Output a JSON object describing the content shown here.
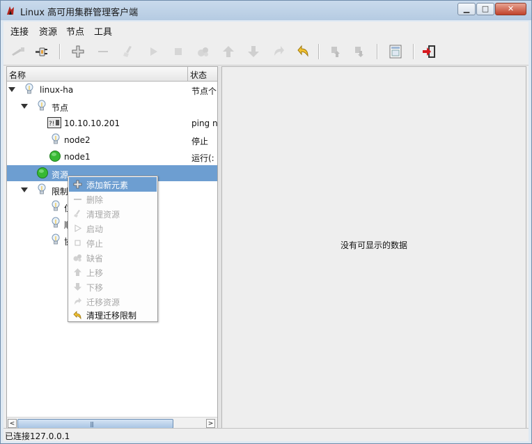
{
  "window": {
    "title": "Linux 高可用集群管理客户端"
  },
  "menubar": {
    "items": [
      "连接",
      "资源",
      "节点",
      "工具"
    ]
  },
  "toolbar": {
    "buttons": [
      "disconnect-icon",
      "connect-icon",
      "add-icon",
      "remove-icon",
      "cleanup-icon",
      "start-icon",
      "stop-icon",
      "default-icon",
      "move-up-icon",
      "move-down-icon",
      "migrate-icon",
      "clear-migration-icon",
      "node-standby-icon",
      "node-online-icon",
      "view-xml-icon",
      "exit-icon"
    ]
  },
  "tree": {
    "headers": {
      "name": "名称",
      "status": "状态"
    },
    "rows": [
      {
        "label": "linux-ha",
        "status": "节点个",
        "icon": "bulb-icon"
      },
      {
        "label": "节点",
        "status": "",
        "icon": "bulb-icon"
      },
      {
        "label": "10.10.10.201",
        "status": "ping n",
        "icon": "ping-node-icon"
      },
      {
        "label": "node2",
        "status": "停止",
        "icon": "bulb-icon"
      },
      {
        "label": "node1",
        "status": "运行(:",
        "icon": "green-circle-icon"
      },
      {
        "label": "资源",
        "status": "",
        "icon": "green-circle-icon"
      },
      {
        "label": "限制",
        "status": "",
        "icon": "bulb-icon"
      },
      {
        "label": "位",
        "status": "",
        "icon": "bulb-icon"
      },
      {
        "label": "顺",
        "status": "",
        "icon": "bulb-icon"
      },
      {
        "label": "协",
        "status": "",
        "icon": "bulb-icon"
      }
    ]
  },
  "right_panel": {
    "empty_message": "没有可显示的数据"
  },
  "statusbar": {
    "text": "已连接127.0.0.1"
  },
  "context_menu": {
    "items": [
      {
        "label": "添加新元素",
        "icon": "add-icon",
        "enabled": true,
        "highlighted": true
      },
      {
        "label": "删除",
        "icon": "remove-icon",
        "enabled": false
      },
      {
        "label": "清理资源",
        "icon": "cleanup-icon",
        "enabled": false
      },
      {
        "label": "启动",
        "icon": "start-icon",
        "enabled": false
      },
      {
        "label": "停止",
        "icon": "stop-icon",
        "enabled": false
      },
      {
        "label": "缺省",
        "icon": "default-icon",
        "enabled": false
      },
      {
        "label": "上移",
        "icon": "move-up-icon",
        "enabled": false
      },
      {
        "label": "下移",
        "icon": "move-down-icon",
        "enabled": false
      },
      {
        "label": "迁移资源",
        "icon": "migrate-icon",
        "enabled": false
      },
      {
        "label": "清理迁移限制",
        "icon": "clear-migration-icon",
        "enabled": true
      }
    ]
  }
}
